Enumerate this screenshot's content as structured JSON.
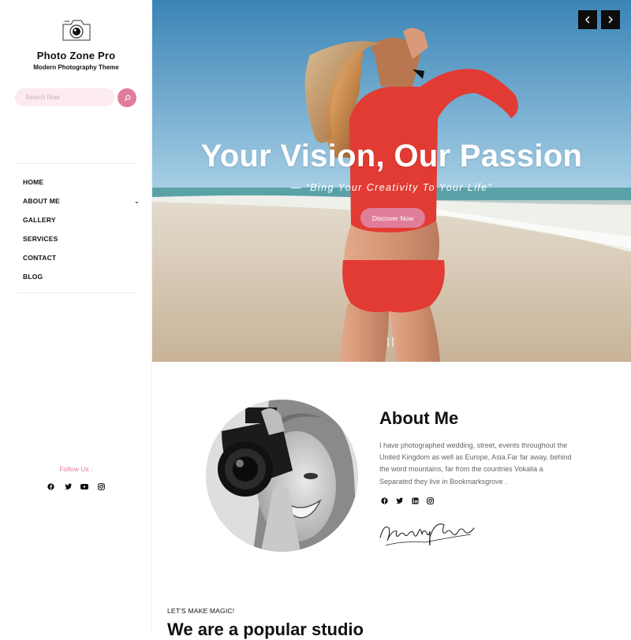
{
  "site": {
    "title": "Photo Zone Pro",
    "tagline": "Modern Photography Theme"
  },
  "search": {
    "placeholder": "Search Now"
  },
  "nav": {
    "items": [
      {
        "label": "HOME"
      },
      {
        "label": "ABOUT ME",
        "has_submenu": true
      },
      {
        "label": "GALLERY"
      },
      {
        "label": "SERVICES"
      },
      {
        "label": "CONTACT"
      },
      {
        "label": "BLOG"
      }
    ]
  },
  "follow": {
    "label": "Follow Us :",
    "icons": [
      "facebook-icon",
      "twitter-icon",
      "youtube-icon",
      "instagram-icon"
    ]
  },
  "hero": {
    "title": "Your Vision, Our Passion",
    "subtitle": "— “Bing Your Creativity To Your Life”",
    "cta_label": "Discover Now",
    "prev_icon": "chevron-left-icon",
    "next_icon": "chevron-right-icon"
  },
  "about": {
    "title": "About Me",
    "body": "I have photographed wedding, street, events throughout the United Kingdom as well as Europe, Asia.Far far away, behind the word mountains, far from the countries Vokalia a Separated they live in Bookmarksgrove .",
    "icons": [
      "facebook-icon",
      "twitter-icon",
      "linkedin-icon",
      "instagram-icon"
    ]
  },
  "studio": {
    "kicker": "LET'S MAKE MAGIC!",
    "title": "We are a popular studio"
  },
  "colors": {
    "accent": "#e07d9a",
    "search_bg": "#fbeaee",
    "dark": "#0d0d0d"
  }
}
